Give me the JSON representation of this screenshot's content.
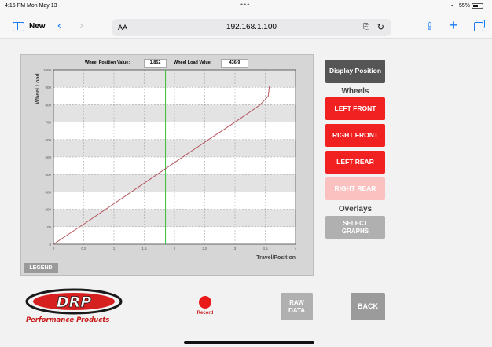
{
  "status_bar": {
    "time": "4:15 PM  Mon May 13",
    "dots": "•••",
    "battery": "55%"
  },
  "browser": {
    "new_label": "New",
    "text_size": "AA",
    "url": "192.168.1.100"
  },
  "readouts": {
    "position_label": "Wheel Position Value:",
    "position_value": "1.852",
    "load_label": "Wheel Load Value:",
    "load_value": "436.9"
  },
  "legend_label": "LEGEND",
  "buttons": {
    "display_position": "Display Position",
    "wheels_heading": "Wheels",
    "left_front": "LEFT FRONT",
    "right_front": "RIGHT FRONT",
    "left_rear": "LEFT REAR",
    "right_rear": "RIGHT REAR",
    "overlays_heading": "Overlays",
    "select_graphs": "SELECT GRAPHS",
    "raw_data": "RAW DATA",
    "back": "BACK",
    "record": "Record"
  },
  "logo": {
    "brand": "DRP",
    "tagline": "Performance Products"
  },
  "colors": {
    "accent_red": "#f22121",
    "disabled_red": "#fbc1c1",
    "ios_blue": "#1a7cf5",
    "curve": "#b5545e",
    "cursor": "#22bb22"
  },
  "chart_data": {
    "type": "line",
    "xlabel": "Travel/Position",
    "ylabel": "Wheel Load",
    "xlim": [
      0,
      4
    ],
    "ylim": [
      0,
      1000
    ],
    "x_ticks": [
      "0",
      "0.5",
      "1",
      "1.5",
      "2",
      "2.5",
      "3",
      "3.5",
      "4"
    ],
    "y_ticks": [
      "0",
      "100",
      "200",
      "300",
      "400",
      "500",
      "600",
      "700",
      "800",
      "900",
      "1000"
    ],
    "cursor_x": 1.852,
    "series": [
      {
        "x": [
          0,
          0.5,
          1,
          1.5,
          2,
          2.5,
          3,
          3.4,
          3.5,
          3.55,
          3.56,
          3.57
        ],
        "y": [
          0,
          115,
          232,
          350,
          468,
          585,
          700,
          795,
          830,
          850,
          880,
          910
        ]
      }
    ]
  }
}
